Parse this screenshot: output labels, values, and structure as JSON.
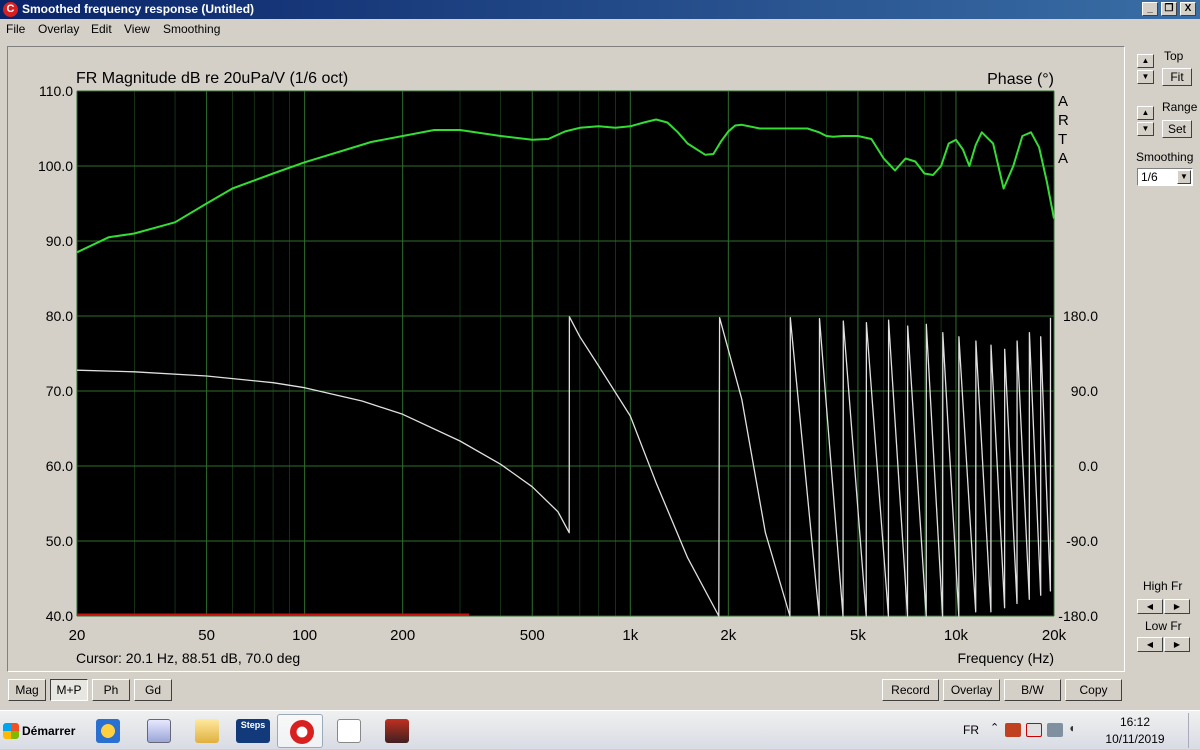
{
  "window": {
    "title": "Smoothed frequency response (Untitled)",
    "app_icon": "C",
    "controls": [
      "_",
      "❐",
      "X"
    ]
  },
  "menu": [
    "File",
    "Overlay",
    "Edit",
    "View",
    "Smoothing"
  ],
  "chart_data": {
    "type": "line",
    "title": "FR Magnitude dB re 20uPa/V (1/6 oct)",
    "y2title": "Phase (°)",
    "watermark": [
      "A",
      "R",
      "T",
      "A"
    ],
    "xlabel": "Frequency (Hz)",
    "xscale": "log",
    "xlim": [
      20,
      20000
    ],
    "ylim": [
      40,
      110
    ],
    "y2lim": [
      -180,
      180
    ],
    "x_ticks": [
      "20",
      "50",
      "100",
      "200",
      "500",
      "1k",
      "2k",
      "5k",
      "10k",
      "20k"
    ],
    "x_tick_values": [
      20,
      50,
      100,
      200,
      500,
      1000,
      2000,
      5000,
      10000,
      20000
    ],
    "y_ticks": [
      "110.0",
      "100.0",
      "90.0",
      "80.0",
      "70.0",
      "60.0",
      "50.0",
      "40.0"
    ],
    "y_tick_values": [
      110,
      100,
      90,
      80,
      70,
      60,
      50,
      40
    ],
    "y2_ticks": [
      "180.0",
      "90.0",
      "0.0",
      "-90.0",
      "-180.0"
    ],
    "y2_tick_values": [
      180,
      90,
      0,
      -90,
      -180
    ],
    "grid": true,
    "colors": {
      "background": "#000000",
      "grid": "#2e6e2e",
      "magnitude": "#33dd33",
      "phase": "#e0e0e0",
      "limit": "#cc1111"
    },
    "cursor_text": "Cursor: 20.1 Hz, 88.51 dB, 70.0 deg",
    "series": [
      {
        "type": "line",
        "axis": "left",
        "x": [
          20,
          25,
          30,
          40,
          50,
          60,
          80,
          100,
          130,
          160,
          200,
          250,
          300,
          400,
          500,
          560,
          630,
          700,
          800,
          900,
          1000,
          1100,
          1200,
          1300,
          1400,
          1500,
          1700,
          1800,
          1900,
          2000,
          2100,
          2200,
          2500,
          3000,
          3500,
          3800,
          4000,
          4200,
          4500,
          5000,
          5500,
          6000,
          6500,
          7000,
          7500,
          8000,
          8500,
          9000,
          9500,
          10000,
          10500,
          11000,
          11500,
          12000,
          13000,
          14000,
          15000,
          16000,
          17000,
          18000,
          19000,
          20000
        ],
        "values": [
          88.5,
          90.5,
          91.0,
          92.5,
          95.0,
          97.0,
          99.0,
          100.5,
          102.0,
          103.2,
          104.0,
          104.8,
          104.8,
          104.0,
          103.5,
          103.6,
          104.6,
          105.1,
          105.3,
          105.1,
          105.3,
          105.8,
          106.2,
          105.8,
          104.5,
          103.0,
          101.5,
          101.6,
          103.3,
          104.6,
          105.4,
          105.5,
          105.0,
          105.0,
          105.0,
          104.5,
          104.0,
          103.9,
          104.0,
          104.0,
          103.6,
          101.0,
          99.4,
          101.0,
          100.6,
          99.0,
          98.8,
          100.0,
          103.0,
          103.5,
          102.2,
          100.0,
          102.8,
          104.5,
          103.0,
          97.0,
          100.0,
          104.0,
          104.5,
          102.5,
          98.0,
          93.0
        ]
      },
      {
        "type": "line",
        "axis": "right",
        "x": [
          20,
          30,
          50,
          80,
          100,
          150,
          200,
          300,
          400,
          500,
          600,
          649,
          650,
          700,
          800,
          1000,
          1200,
          1500,
          1870,
          1880,
          2200,
          2600,
          3090,
          3100,
          3800,
          3810,
          4500,
          4510,
          5300,
          5310,
          6200,
          6210,
          7100,
          7110,
          8100,
          8110,
          9100,
          9110,
          10200,
          10210,
          11500,
          11510,
          12800,
          12810,
          14100,
          14110,
          15400,
          15410,
          16800,
          16810,
          18200,
          18210,
          19500,
          19510
        ],
        "values": [
          115,
          113,
          108,
          100,
          94,
          78,
          62,
          30,
          2,
          -25,
          -55,
          -80,
          179,
          155,
          120,
          60,
          -20,
          -110,
          -180,
          178,
          80,
          -80,
          -180,
          178,
          -180,
          177,
          -180,
          174,
          -180,
          172,
          -180,
          175,
          -180,
          168,
          -180,
          170,
          -180,
          160,
          -180,
          155,
          -175,
          150,
          -175,
          145,
          -170,
          140,
          -165,
          150,
          -160,
          160,
          -155,
          155,
          -150,
          178
        ]
      },
      {
        "type": "line",
        "axis": "left",
        "name": "",
        "x": [
          20,
          320
        ],
        "values": [
          40.2,
          40.2
        ]
      }
    ]
  },
  "right_panel": {
    "top_label": "Top",
    "fit_label": "Fit",
    "range_label": "Range",
    "set_label": "Set",
    "smoothing_label": "Smoothing",
    "smoothing_value": "1/6",
    "high_fr_label": "High Fr",
    "low_fr_label": "Low Fr"
  },
  "bottom_bar": {
    "mag": "Mag",
    "mp": "M+P",
    "ph": "Ph",
    "gd": "Gd",
    "record": "Record",
    "overlay": "Overlay",
    "bw": "B/W",
    "copy": "Copy"
  },
  "taskbar": {
    "start_label": "Démarrer",
    "apps": [
      "media-player",
      "calculator",
      "explorer",
      "steps",
      "arta",
      "limp",
      "photo"
    ],
    "steps_label": "Steps",
    "lang": "FR",
    "time": "16:12",
    "date": "10/11/2019"
  }
}
